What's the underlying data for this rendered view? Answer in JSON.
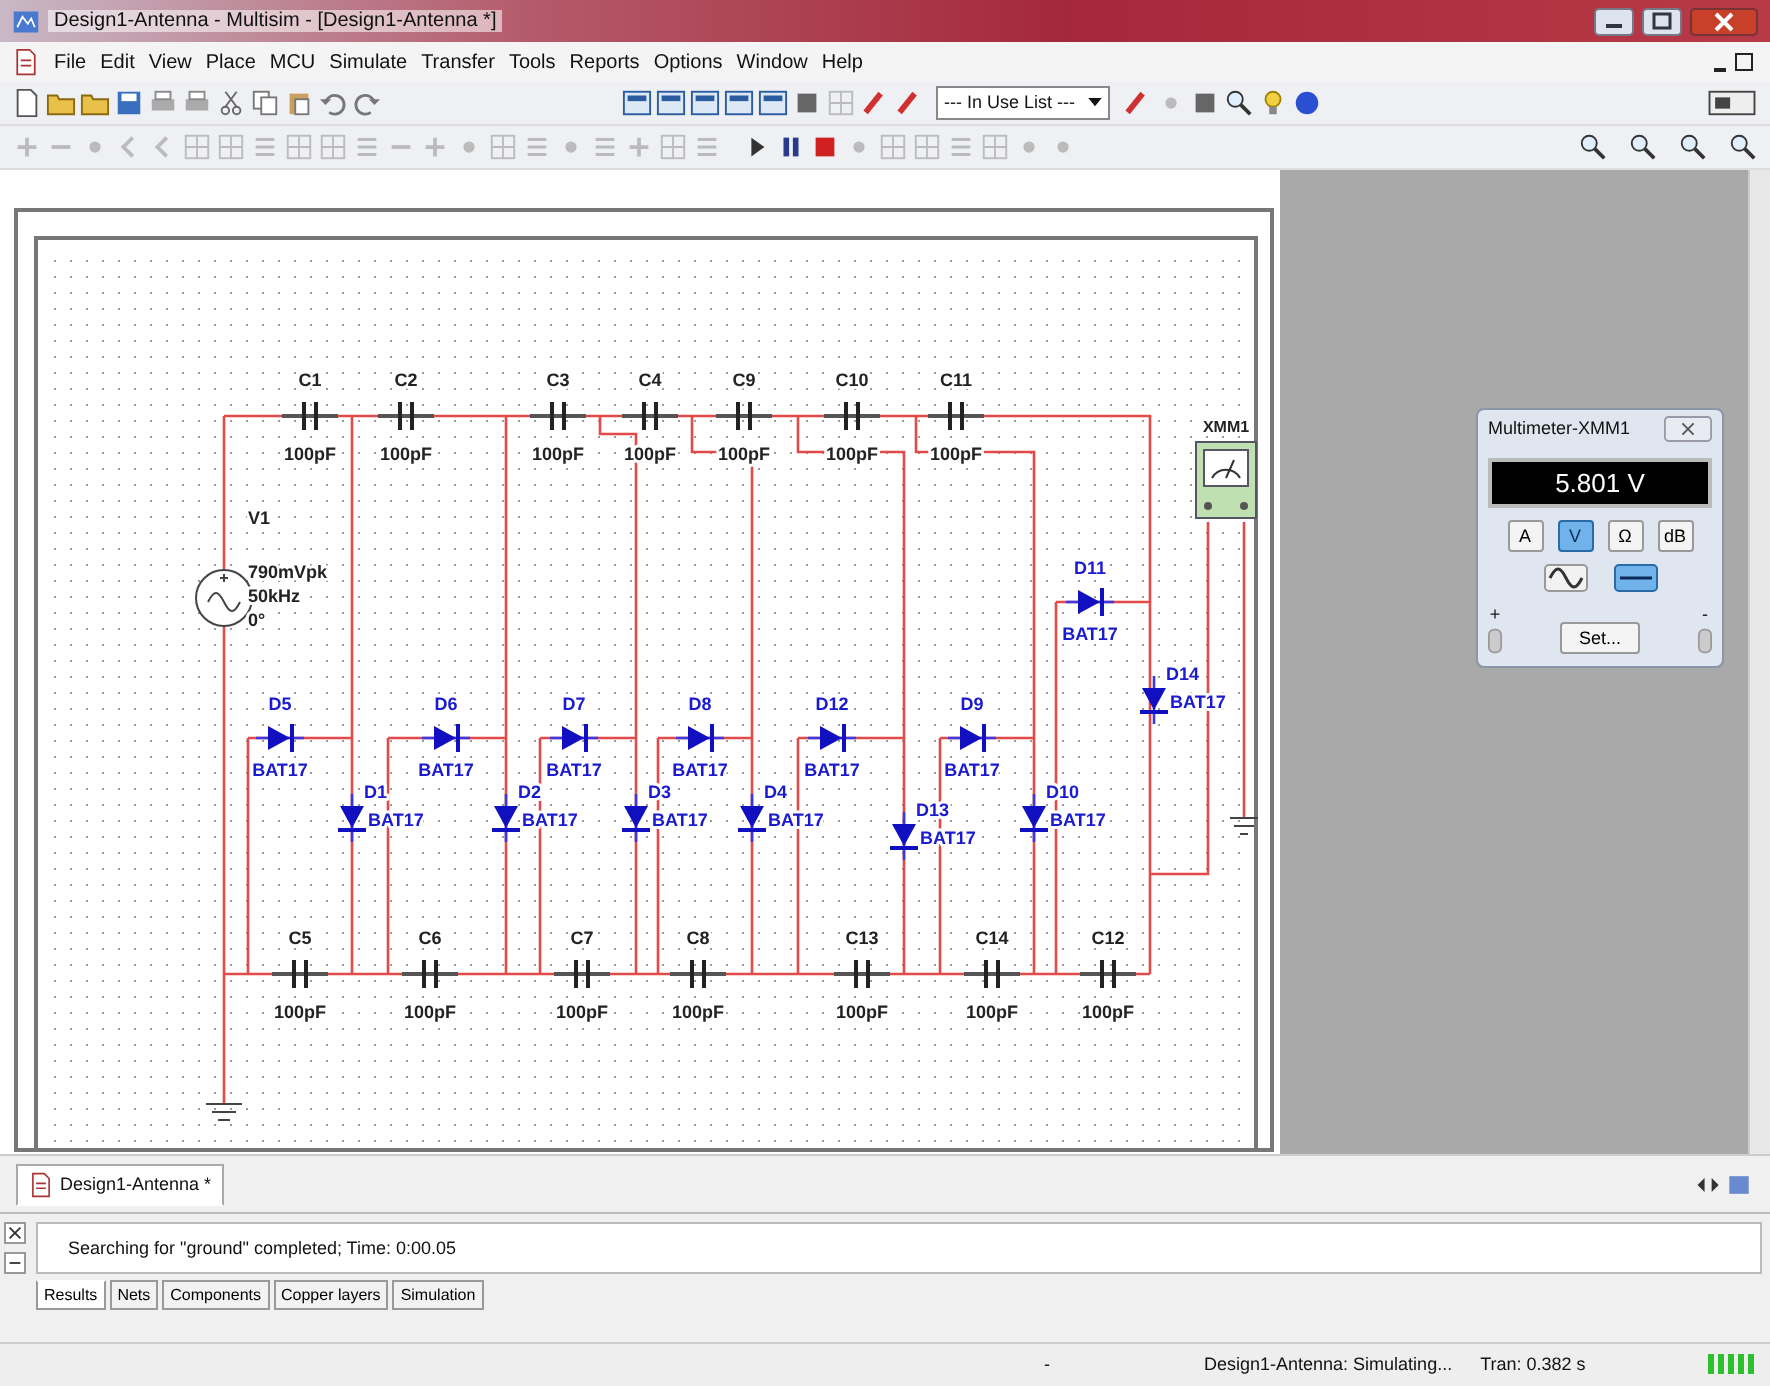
{
  "window": {
    "title": "Design1-Antenna - Multisim - [Design1-Antenna *]"
  },
  "menu": [
    "File",
    "Edit",
    "View",
    "Place",
    "MCU",
    "Simulate",
    "Transfer",
    "Tools",
    "Reports",
    "Options",
    "Window",
    "Help"
  ],
  "toolbar": {
    "list_combo": "--- In Use List ---"
  },
  "schematic": {
    "top_capacitors": [
      {
        "name": "C1",
        "value": "100pF"
      },
      {
        "name": "C2",
        "value": "100pF"
      },
      {
        "name": "C3",
        "value": "100pF"
      },
      {
        "name": "C4",
        "value": "100pF"
      },
      {
        "name": "C9",
        "value": "100pF"
      },
      {
        "name": "C10",
        "value": "100pF"
      },
      {
        "name": "C11",
        "value": "100pF"
      }
    ],
    "bottom_capacitors": [
      {
        "name": "C5",
        "value": "100pF"
      },
      {
        "name": "C6",
        "value": "100pF"
      },
      {
        "name": "C7",
        "value": "100pF"
      },
      {
        "name": "C8",
        "value": "100pF"
      },
      {
        "name": "C13",
        "value": "100pF"
      },
      {
        "name": "C14",
        "value": "100pF"
      },
      {
        "name": "C12",
        "value": "100pF"
      }
    ],
    "series_diodes": [
      {
        "name": "D5",
        "model": "BAT17"
      },
      {
        "name": "D6",
        "model": "BAT17"
      },
      {
        "name": "D7",
        "model": "BAT17"
      },
      {
        "name": "D8",
        "model": "BAT17"
      },
      {
        "name": "D12",
        "model": "BAT17"
      },
      {
        "name": "D9",
        "model": "BAT17"
      },
      {
        "name": "D11",
        "model": "BAT17"
      }
    ],
    "shunt_diodes": [
      {
        "name": "D1",
        "model": "BAT17"
      },
      {
        "name": "D2",
        "model": "BAT17"
      },
      {
        "name": "D3",
        "model": "BAT17"
      },
      {
        "name": "D4",
        "model": "BAT17"
      },
      {
        "name": "D13",
        "model": "BAT17"
      },
      {
        "name": "D10",
        "model": "BAT17"
      },
      {
        "name": "D14",
        "model": "BAT17"
      }
    ],
    "source": {
      "name": "V1",
      "lines": [
        "790mVpk",
        "50kHz",
        "0°"
      ]
    },
    "meter_label": "XMM1"
  },
  "multimeter": {
    "title": "Multimeter-XMM1",
    "reading": "5.801 V",
    "modes": [
      {
        "label": "A",
        "selected": false
      },
      {
        "label": "V",
        "selected": true
      },
      {
        "label": "Ω",
        "selected": false
      },
      {
        "label": "dB",
        "selected": false
      }
    ],
    "coupling": [
      {
        "kind": "ac",
        "selected": false
      },
      {
        "kind": "dc",
        "selected": true
      }
    ],
    "set_button": "Set...",
    "terminals": [
      "+",
      "-"
    ]
  },
  "document_tabs": [
    {
      "label": "Design1-Antenna *",
      "selected": true
    }
  ],
  "spreadsheet": {
    "message": "Searching for \"ground\" completed;  Time: 0:00.05",
    "tabs": [
      {
        "label": "Results",
        "selected": true
      },
      {
        "label": "Nets",
        "selected": false
      },
      {
        "label": "Components",
        "selected": false
      },
      {
        "label": "Copper layers",
        "selected": false
      },
      {
        "label": "Simulation",
        "selected": false
      }
    ]
  },
  "status_bar": {
    "fields": [
      "-",
      "Design1-Antenna: Simulating...",
      "Tran: 0.382 s"
    ]
  }
}
